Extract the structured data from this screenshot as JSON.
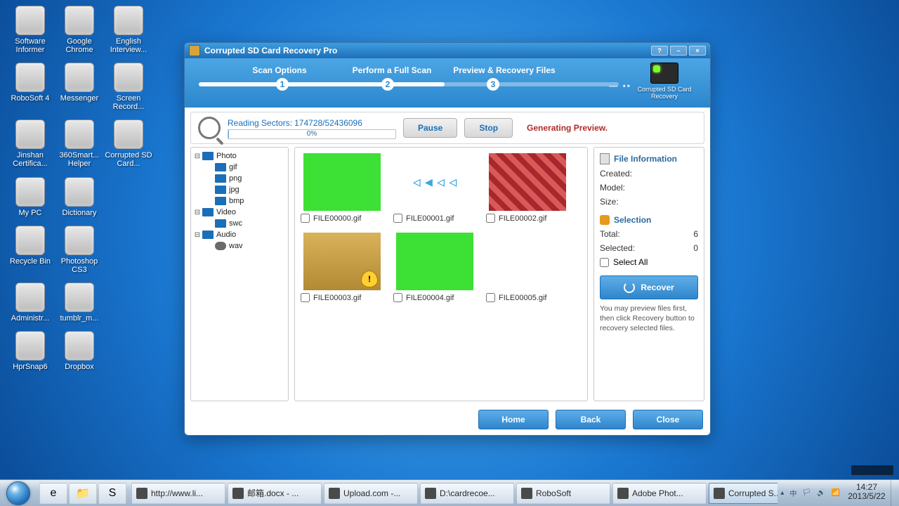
{
  "desktop_icons": [
    {
      "label": "Software Informer"
    },
    {
      "label": "Google Chrome"
    },
    {
      "label": "English Interview..."
    },
    {
      "label": "RoboSoft 4"
    },
    {
      "label": "Messenger"
    },
    {
      "label": "Screen Record..."
    },
    {
      "label": "Jinshan Certifica..."
    },
    {
      "label": "360Smart... Helper"
    },
    {
      "label": "Corrupted SD Card..."
    },
    {
      "label": "My PC"
    },
    {
      "label": "Dictionary"
    },
    {
      "label": ""
    },
    {
      "label": "Recycle Bin"
    },
    {
      "label": "Photoshop CS3"
    },
    {
      "label": ""
    },
    {
      "label": "Administr..."
    },
    {
      "label": "tumblr_m..."
    },
    {
      "label": ""
    },
    {
      "label": "HprSnap6"
    },
    {
      "label": "Dropbox"
    }
  ],
  "app": {
    "title": "Corrupted SD Card Recovery Pro",
    "steps": [
      {
        "label": "Scan Options"
      },
      {
        "label": "Perform a Full Scan"
      },
      {
        "label": "Preview & Recovery Files"
      }
    ],
    "sdcard_caption": "Corrupted SD Card Recovery",
    "progress": {
      "label": "Reading Sectors:",
      "value": "174728/52436096",
      "percent": "0%"
    },
    "btn_pause": "Pause",
    "btn_stop": "Stop",
    "status": "Generating Preview.",
    "tree": [
      {
        "label": "Photo",
        "children": [
          "gif",
          "png",
          "jpg",
          "bmp"
        ]
      },
      {
        "label": "Video",
        "children": [
          "swc"
        ]
      },
      {
        "label": "Audio",
        "children": [
          "wav"
        ]
      }
    ],
    "thumbs": [
      {
        "name": "FILE00000.gif",
        "cls": "green"
      },
      {
        "name": "FILE00001.gif",
        "cls": "cursors"
      },
      {
        "name": "FILE00002.gif",
        "cls": "pixel"
      },
      {
        "name": "FILE00003.gif",
        "cls": "folder"
      },
      {
        "name": "FILE00004.gif",
        "cls": "green"
      },
      {
        "name": "FILE00005.gif",
        "cls": "rockets"
      }
    ],
    "info": {
      "head_file": "File Information",
      "created": "Created:",
      "model": "Model:",
      "size": "Size:",
      "head_sel": "Selection",
      "total_lbl": "Total:",
      "total_val": "6",
      "sel_lbl": "Selected:",
      "sel_val": "0",
      "selectall": "Select All",
      "recover": "Recover",
      "hint": "You may preview files first, then click Recovery button to recovery selected files."
    },
    "footer": {
      "home": "Home",
      "back": "Back",
      "close": "Close"
    }
  },
  "taskbar": {
    "tasks": [
      {
        "label": "http://www.li..."
      },
      {
        "label": "邮箱.docx - ..."
      },
      {
        "label": "Upload.com -..."
      },
      {
        "label": "D:\\cardrecoe..."
      },
      {
        "label": "RoboSoft"
      },
      {
        "label": "Adobe Phot..."
      },
      {
        "label": "Corrupted S...",
        "active": true
      }
    ],
    "time": "14:27",
    "date": "2013/5/22"
  }
}
